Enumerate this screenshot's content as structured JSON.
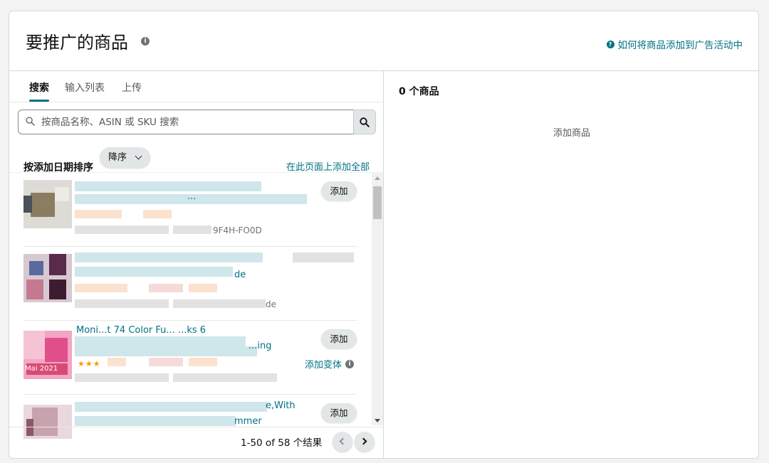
{
  "header": {
    "title": "要推广的商品",
    "info_icon": "i",
    "help_link": "如何将商品添加到广告活动中",
    "help_icon": "?"
  },
  "tabs": [
    {
      "label": "搜索",
      "active": true
    },
    {
      "label": "输入列表",
      "active": false
    },
    {
      "label": "上传",
      "active": false
    }
  ],
  "search": {
    "placeholder": "按商品名称、ASIN 或 SKU 搜索",
    "value": ""
  },
  "sort": {
    "label": "按添加日期排序",
    "selected": "降序",
    "add_all_link": "在此页面上添加全部"
  },
  "products": [
    {
      "title_fragment": "...",
      "sub_fragment": "9F4H-FO0D",
      "add_label": "添加"
    },
    {
      "title_fragment": "de",
      "sub_fragment": "de",
      "add_label": ""
    },
    {
      "title_fragment": "Moni...t 74 Color Fu... ...ks 6",
      "title_line2": "...ing",
      "stars": "★★★",
      "thumb_text": "Mai 2021",
      "add_label": "添加",
      "variant_label": "添加变体",
      "variant_icon": "i"
    },
    {
      "title_fragment": "e,With",
      "title_line2": "mmer",
      "add_label": "添加"
    }
  ],
  "pager": {
    "text": "1-50 of 58 个结果"
  },
  "right": {
    "count_label": "0 个商品",
    "empty_text": "添加商品"
  },
  "colors": {
    "link": "#007185",
    "button_bg": "#e3e6e6",
    "border": "#d5d9d9",
    "star": "#ff9900"
  }
}
